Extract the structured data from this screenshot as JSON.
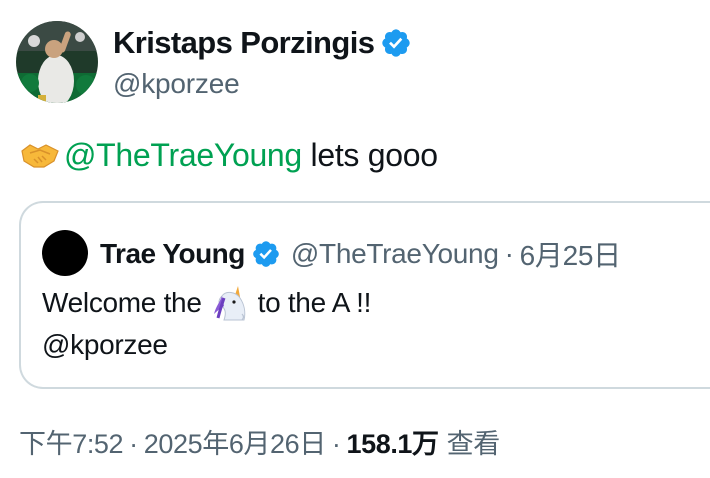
{
  "post": {
    "author": {
      "display_name": "Kristaps Porzingis",
      "handle": "@kporzee",
      "verified": true,
      "avatar_icon": "player-photo-avatar"
    },
    "text": {
      "emoji": "handshake-emoji",
      "mention": "@TheTraeYoung",
      "rest": " lets gooo"
    },
    "meta": {
      "time": "下午7:52",
      "separator": "·",
      "date": "2025年6月26日",
      "views_count": "158.1万",
      "views_label": "查看"
    }
  },
  "quoted_post": {
    "author": {
      "display_name": "Trae Young",
      "handle": "@TheTraeYoung",
      "verified": true
    },
    "separator": "·",
    "date": "6月25日",
    "text": {
      "line1_before": "Welcome the",
      "line1_emoji": "unicorn-emoji",
      "line1_after": "to the A !!",
      "line2": "@kporzee"
    }
  },
  "colors": {
    "verified_blue": "#1d9bf0",
    "mention_color": "#00a152",
    "secondary_text": "#536471",
    "border": "#cfd9de"
  }
}
